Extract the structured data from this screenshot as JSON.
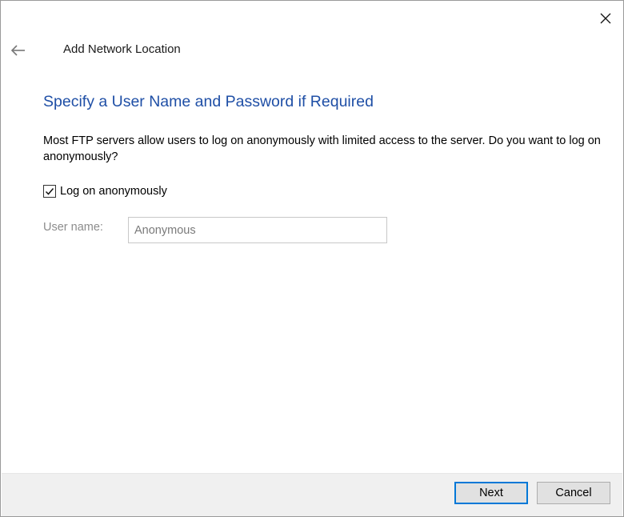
{
  "window": {
    "title": "Add Network Location",
    "back_icon": "arrow-left-icon",
    "close_icon": "close-icon"
  },
  "page": {
    "heading": "Specify a User Name and Password if Required",
    "description": "Most FTP servers allow users to log on anonymously with limited access to the server.  Do you want to log on anonymously?",
    "checkbox": {
      "label": "Log on anonymously",
      "checked": true
    },
    "username": {
      "label": "User name:",
      "value": "Anonymous"
    }
  },
  "footer": {
    "next_label": "Next",
    "cancel_label": "Cancel"
  },
  "colors": {
    "heading": "#1f4fa6",
    "accent": "#0078d7",
    "footer_bg": "#f0f0f0"
  }
}
